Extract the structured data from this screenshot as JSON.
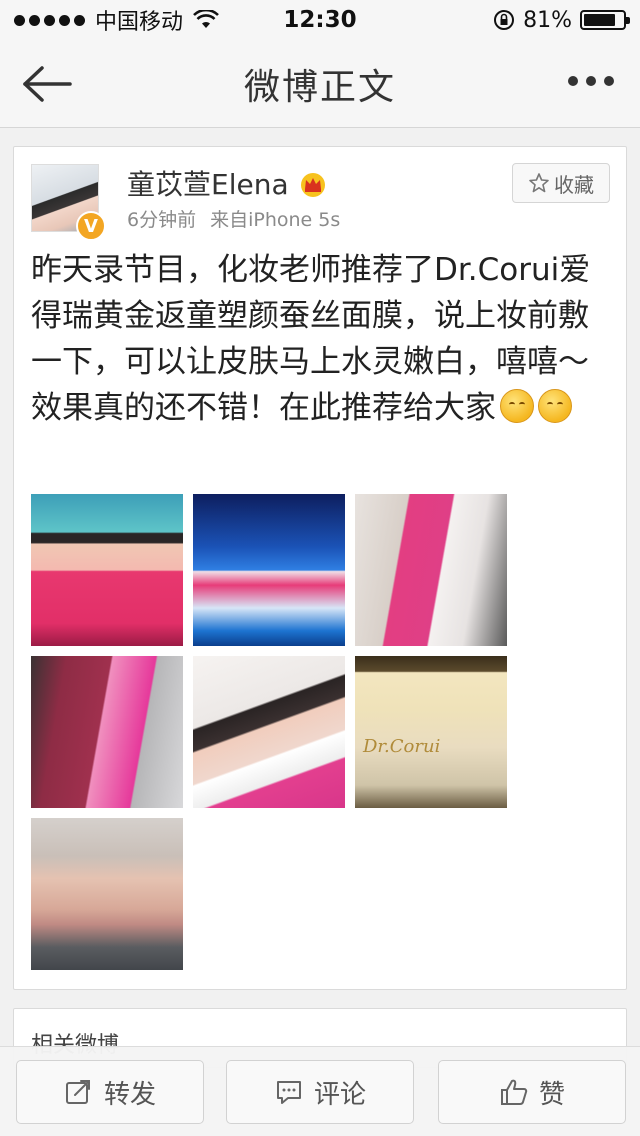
{
  "status_bar": {
    "carrier": "中国移动",
    "time": "12:30",
    "battery": "81%",
    "battery_level": 0.81
  },
  "nav": {
    "title": "微博正文",
    "back_icon": "back-arrow-icon",
    "more_icon": "more-dots-icon"
  },
  "post": {
    "user_name": "童苡萱Elena",
    "time_ago": "6分钟前",
    "source": "来自iPhone 5s",
    "favorite_label": "收藏",
    "verified_mark": "V",
    "text": "昨天录节目，化妆老师推荐了Dr.Corui爱得瑞黄金返童塑颜蚕丝面膜，说上妆前敷一下，可以让皮肤马上水灵嫩白，嘻嘻～效果真的还不错！在此推荐给大家",
    "emoji_count": 2,
    "photo_count": 7,
    "photo_brand_text": "Dr.Corui"
  },
  "related": {
    "title": "相关微博"
  },
  "toolbar": {
    "repost_label": "转发",
    "comment_label": "评论",
    "like_label": "赞"
  },
  "colors": {
    "verified_badge": "#f3a623",
    "background": "#f1f1f1"
  }
}
